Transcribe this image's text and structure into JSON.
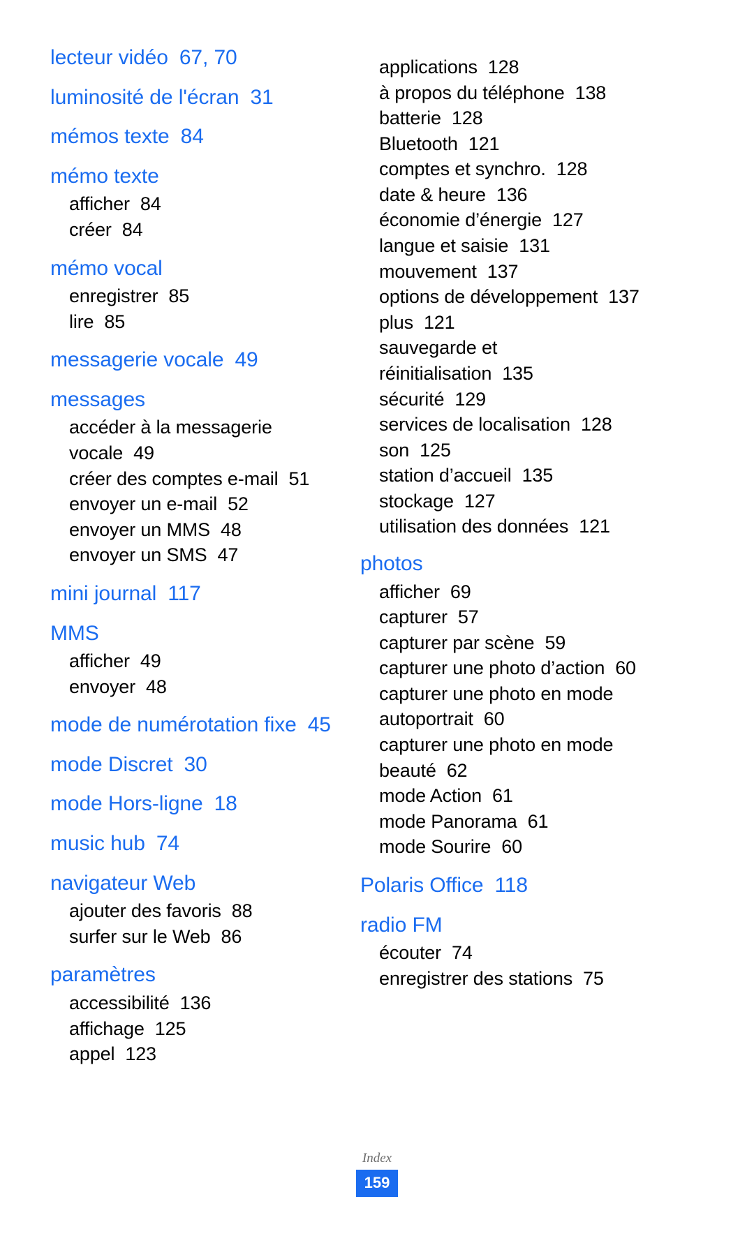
{
  "document": {
    "type": "index-page",
    "language": "fr",
    "accent_color": "#1a6cf0",
    "text_color": "#000000",
    "footer": {
      "label": "Index",
      "page_number": "159"
    }
  },
  "left_column": {
    "groups": [
      {
        "heading": "lecteur vidéo",
        "heading_page": "67, 70",
        "subs": []
      },
      {
        "heading": "luminosité de l'écran",
        "heading_page": "31",
        "subs": []
      },
      {
        "heading": "mémos texte",
        "heading_page": "84",
        "subs": []
      },
      {
        "heading": "mémo texte",
        "heading_page": "",
        "subs": [
          {
            "label": "afficher",
            "page": "84"
          },
          {
            "label": "créer",
            "page": "84"
          }
        ]
      },
      {
        "heading": "mémo vocal",
        "heading_page": "",
        "subs": [
          {
            "label": "enregistrer",
            "page": "85"
          },
          {
            "label": "lire",
            "page": "85"
          }
        ]
      },
      {
        "heading": "messagerie vocale",
        "heading_page": "49",
        "subs": []
      },
      {
        "heading": "messages",
        "heading_page": "",
        "subs": [
          {
            "label": "accéder à la messagerie vocale",
            "page": "49"
          },
          {
            "label": "créer des comptes e-mail",
            "page": "51"
          },
          {
            "label": "envoyer un e-mail",
            "page": "52"
          },
          {
            "label": "envoyer un MMS",
            "page": "48"
          },
          {
            "label": "envoyer un SMS",
            "page": "47"
          }
        ]
      },
      {
        "heading": "mini journal",
        "heading_page": "117",
        "subs": []
      },
      {
        "heading": "MMS",
        "heading_page": "",
        "subs": [
          {
            "label": "afficher",
            "page": "49"
          },
          {
            "label": "envoyer",
            "page": "48"
          }
        ]
      },
      {
        "heading": "mode de numérotation fixe",
        "heading_page": "45",
        "subs": []
      },
      {
        "heading": "mode Discret",
        "heading_page": "30",
        "subs": []
      },
      {
        "heading": "mode Hors-ligne",
        "heading_page": "18",
        "subs": []
      },
      {
        "heading": "music hub",
        "heading_page": "74",
        "subs": []
      },
      {
        "heading": "navigateur Web",
        "heading_page": "",
        "subs": [
          {
            "label": "ajouter des favoris",
            "page": "88"
          },
          {
            "label": "surfer sur le Web",
            "page": "86"
          }
        ]
      },
      {
        "heading": "paramètres",
        "heading_page": "",
        "subs": [
          {
            "label": "accessibilité",
            "page": "136"
          },
          {
            "label": "affichage",
            "page": "125"
          },
          {
            "label": "appel",
            "page": "123"
          }
        ]
      }
    ]
  },
  "right_column": {
    "continued_subs": [
      {
        "label": "applications",
        "page": "128"
      },
      {
        "label": "à propos du téléphone",
        "page": "138"
      },
      {
        "label": "batterie",
        "page": "128"
      },
      {
        "label": "Bluetooth",
        "page": "121"
      },
      {
        "label": "comptes et synchro.",
        "page": "128"
      },
      {
        "label": "date & heure",
        "page": "136"
      },
      {
        "label": "économie d’énergie",
        "page": "127"
      },
      {
        "label": "langue et saisie",
        "page": "131"
      },
      {
        "label": "mouvement",
        "page": "137"
      },
      {
        "label": "options de développement",
        "page": "137"
      },
      {
        "label": "plus",
        "page": "121"
      },
      {
        "label": "sauvegarde et réinitialisation",
        "page": "135"
      },
      {
        "label": "sécurité",
        "page": "129"
      },
      {
        "label": "services de localisation",
        "page": "128"
      },
      {
        "label": "son",
        "page": "125"
      },
      {
        "label": "station d’accueil",
        "page": "135"
      },
      {
        "label": "stockage",
        "page": "127"
      },
      {
        "label": "utilisation des données",
        "page": "121"
      }
    ],
    "groups": [
      {
        "heading": "photos",
        "heading_page": "",
        "subs": [
          {
            "label": "afficher",
            "page": "69"
          },
          {
            "label": "capturer",
            "page": "57"
          },
          {
            "label": "capturer par scène",
            "page": "59"
          },
          {
            "label": "capturer une photo d’action",
            "page": "60"
          },
          {
            "label": "capturer une photo en mode autoportrait",
            "page": "60"
          },
          {
            "label": "capturer une photo en mode beauté",
            "page": "62"
          },
          {
            "label": "mode Action",
            "page": "61"
          },
          {
            "label": "mode Panorama",
            "page": "61"
          },
          {
            "label": "mode Sourire",
            "page": "60"
          }
        ]
      },
      {
        "heading": "Polaris Office",
        "heading_page": "118",
        "subs": []
      },
      {
        "heading": "radio FM",
        "heading_page": "",
        "subs": [
          {
            "label": "écouter",
            "page": "74"
          },
          {
            "label": "enregistrer des stations",
            "page": "75"
          }
        ]
      }
    ]
  }
}
